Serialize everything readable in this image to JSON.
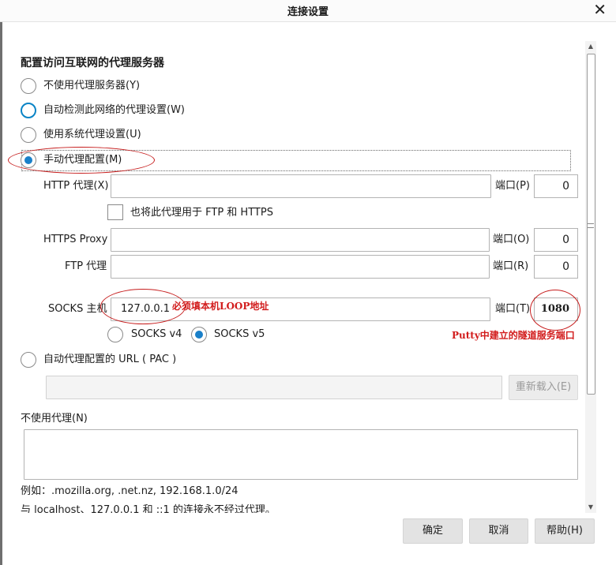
{
  "window": {
    "title": "连接设置",
    "close_glyph": "✕"
  },
  "section_title": "配置访问互联网的代理服务器",
  "options": {
    "no_proxy": "不使用代理服务器(Y)",
    "auto_detect": "自动检测此网络的代理设置(W)",
    "system_proxy": "使用系统代理设置(U)",
    "manual": "手动代理配置(M)"
  },
  "manual": {
    "http_label": "HTTP 代理(X)",
    "http_value": "",
    "http_port_label": "端口(P)",
    "http_port": "0",
    "use_for_all_label": "也将此代理用于 FTP 和 HTTPS",
    "https_label": "HTTPS Proxy",
    "https_value": "",
    "https_port_label": "端口(O)",
    "https_port": "0",
    "ftp_label": "FTP 代理",
    "ftp_value": "",
    "ftp_port_label": "端口(R)",
    "ftp_port": "0",
    "socks_label": "SOCKS 主机",
    "socks_value": "127.0.0.1",
    "socks_port_label": "端口(T)",
    "socks_port": "1080",
    "socks_v4": "SOCKS v4",
    "socks_v5": "SOCKS v5"
  },
  "annotations": {
    "host_note": "必须填本机LOOP地址",
    "port_note": "Putty中建立的隧道服务端口",
    "color": "#d21c1c"
  },
  "pac": {
    "label": "自动代理配置的 URL ( PAC )",
    "value": "",
    "reload_button": "重新载入(E)"
  },
  "no_proxy_for": {
    "label": "不使用代理(N)",
    "value": "",
    "example": "例如：.mozilla.org, .net.nz, 192.168.1.0/24",
    "localhost_note": "与 localhost、127.0.0.1 和 ::1 的连接永不经过代理。"
  },
  "footer": {
    "ok": "确定",
    "cancel": "取消",
    "help": "帮助(H)"
  },
  "colors": {
    "accent": "#1a80c9",
    "annotation": "#d21c1c"
  }
}
